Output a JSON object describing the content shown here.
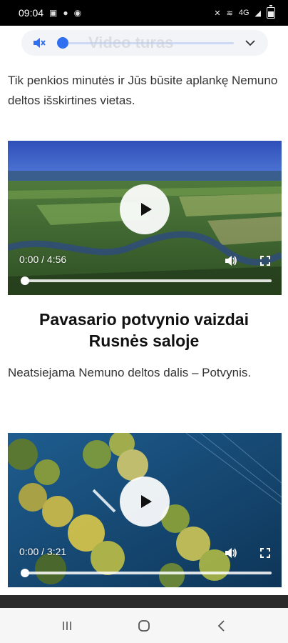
{
  "status_bar": {
    "time": "09:04",
    "left_icons": [
      "image-icon",
      "location-icon",
      "messenger-icon"
    ],
    "right_icons": [
      "mute-icon",
      "wifi-icon",
      "signal-icon",
      "battery-icon"
    ],
    "network_label": "4G"
  },
  "audio_player": {
    "ghost_title": "Video turas",
    "progress": 0
  },
  "intro_text": "Tik penkios minutės ir Jūs būsite aplankę Nemuno deltos išskirtines vietas.",
  "video1": {
    "time": "0:00 / 4:56",
    "progress": 0
  },
  "section": {
    "title": "Pavasario potvynio vaizdai Rusnės saloje",
    "description": "Neatsiejama Nemuno deltos dalis – Potvynis."
  },
  "video2": {
    "time": "0:00 / 3:21",
    "progress": 0
  },
  "colors": {
    "accent": "#2f6ff0",
    "status_bar": "#000000",
    "nav_bar": "#f6f6f6"
  }
}
